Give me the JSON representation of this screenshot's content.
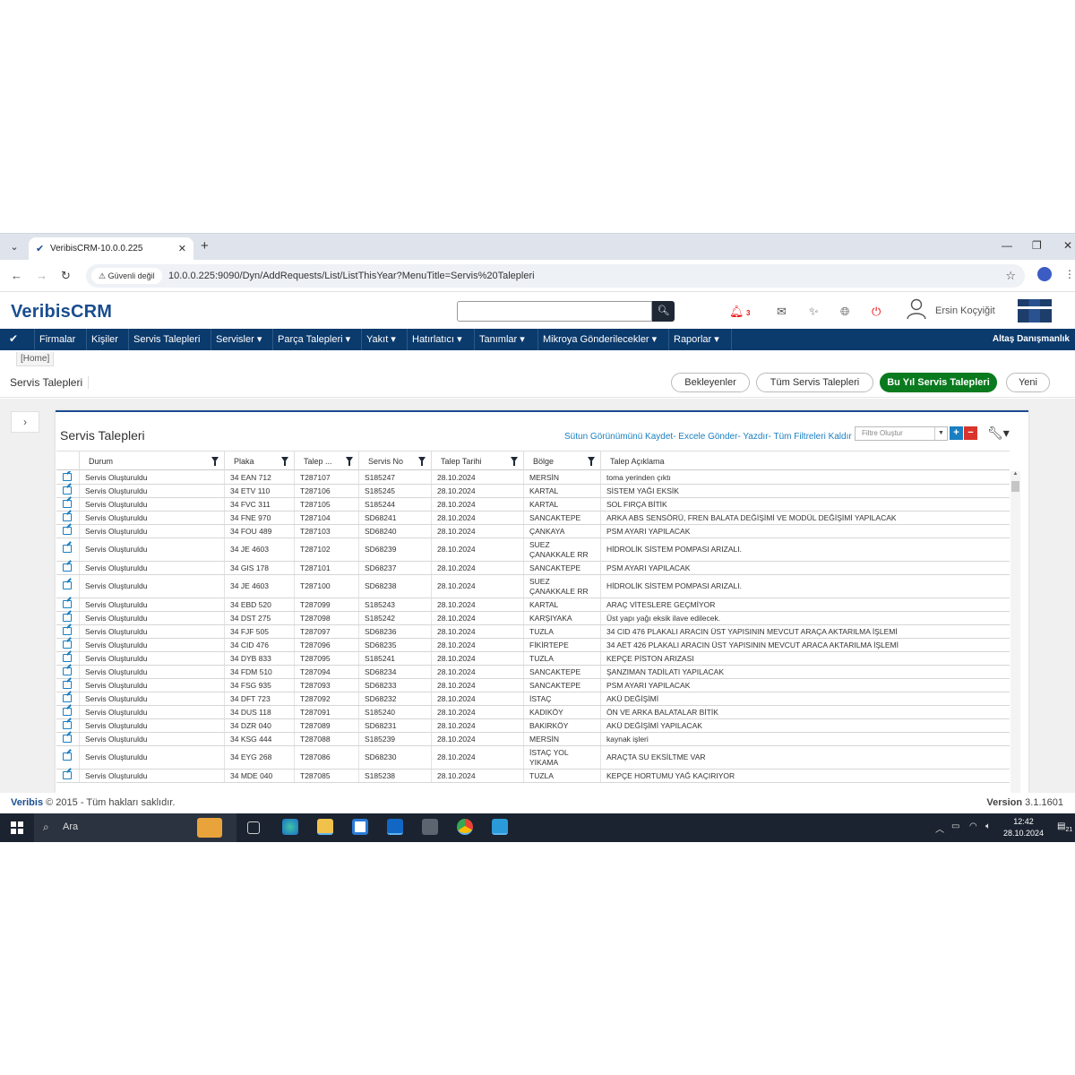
{
  "browser": {
    "tab_title": "VeribisCRM-10.0.0.225",
    "security_label": "Güvenli değil",
    "url": "10.0.0.225:9090/Dyn/AddRequests/List/ListThisYear?MenuTitle=Servis%20Talepleri"
  },
  "app": {
    "logo_a": "Veribis",
    "logo_b": "CRM",
    "notification_count": "3",
    "user_name": "Ersin Koçyiğit"
  },
  "nav": {
    "items": [
      "Firmalar",
      "Kişiler",
      "Servis Talepleri",
      "Servisler ▾",
      "Parça Talepleri ▾",
      "Yakıt ▾",
      "Hatırlatıcı ▾",
      "Tanımlar ▾",
      "Mikroya Gönderilecekler ▾",
      "Raporlar ▾"
    ],
    "company": "Altaş Danışmanlık"
  },
  "breadcrumb": "[Home]",
  "page_title": "Servis Talepleri",
  "buttons": {
    "waiting": "Bekleyenler",
    "all": "Tüm Servis Talepleri",
    "this_year": "Bu Yıl Servis Talepleri",
    "new": "Yeni"
  },
  "panel": {
    "title": "Servis Talepleri",
    "links": "Sütun Görünümünü Kaydet- Excele Gönder- Yazdır- Tüm Filtreleri Kaldır",
    "filter_placeholder": "Filtre Oluştur"
  },
  "columns": [
    "Durum",
    "Plaka",
    "Talep ...",
    "Servis No",
    "Talep Tarihi",
    "Bölge",
    "Talep Açıklama"
  ],
  "rows": [
    [
      "Servis Oluşturuldu",
      "34 EAN 712",
      "T287107",
      "S185247",
      "28.10.2024",
      "MERSİN",
      "toma yerinden çıktı"
    ],
    [
      "Servis Oluşturuldu",
      "34 ETV 110",
      "T287106",
      "S185245",
      "28.10.2024",
      "KARTAL",
      "SİSTEM YAĞI EKSİK"
    ],
    [
      "Servis Oluşturuldu",
      "34 FVC 311",
      "T287105",
      "S185244",
      "28.10.2024",
      "KARTAL",
      "SOL FIRÇA BİTİK"
    ],
    [
      "Servis Oluşturuldu",
      "34 FNE 970",
      "T287104",
      "SD68241",
      "28.10.2024",
      "SANCAKTEPE",
      "ARKA ABS SENSÖRÜ, FREN BALATA DEĞİŞİMİ VE MODÜL DEĞİŞİMİ YAPILACAK"
    ],
    [
      "Servis Oluşturuldu",
      "34 FOU 489",
      "T287103",
      "SD68240",
      "28.10.2024",
      "ÇANKAYA",
      "PSM AYARI YAPILACAK"
    ],
    [
      "Servis Oluşturuldu",
      "34 JE 4603",
      "T287102",
      "SD68239",
      "28.10.2024",
      "SUEZ\nÇANAKKALE RR",
      "HİDROLİK SİSTEM POMPASI ARIZALI."
    ],
    [
      "Servis Oluşturuldu",
      "34 GIS 178",
      "T287101",
      "SD68237",
      "28.10.2024",
      "SANCAKTEPE",
      "PSM AYARI YAPILACAK"
    ],
    [
      "Servis Oluşturuldu",
      "34 JE 4603",
      "T287100",
      "SD68238",
      "28.10.2024",
      "SUEZ\nÇANAKKALE RR",
      "HİDROLİK SİSTEM POMPASI ARIZALI."
    ],
    [
      "Servis Oluşturuldu",
      "34 EBD 520",
      "T287099",
      "S185243",
      "28.10.2024",
      "KARTAL",
      "ARAÇ VİTESLERE GEÇMİYOR"
    ],
    [
      "Servis Oluşturuldu",
      "34 DST 275",
      "T287098",
      "S185242",
      "28.10.2024",
      "KARŞIYAKA",
      "Üst yapı yağı eksik ilave edilecek."
    ],
    [
      "Servis Oluşturuldu",
      "34 FJF 505",
      "T287097",
      "SD68236",
      "28.10.2024",
      "TUZLA",
      "34 CID 476 PLAKALI ARACIN ÜST YAPISININ MEVCUT ARAÇA AKTARILMA İŞLEMİ"
    ],
    [
      "Servis Oluşturuldu",
      "34 CID 476",
      "T287096",
      "SD68235",
      "28.10.2024",
      "FİKİRTEPE",
      "34 AET 426 PLAKALI ARACIN ÜST YAPISININ MEVCUT ARACA AKTARILMA İŞLEMİ"
    ],
    [
      "Servis Oluşturuldu",
      "34 DYB 833",
      "T287095",
      "S185241",
      "28.10.2024",
      "TUZLA",
      "KEPÇE PİSTON ARIZASI"
    ],
    [
      "Servis Oluşturuldu",
      "34 FDM 510",
      "T287094",
      "SD68234",
      "28.10.2024",
      "SANCAKTEPE",
      "ŞANZIMAN TADİLATI YAPILACAK"
    ],
    [
      "Servis Oluşturuldu",
      "34 FSG 935",
      "T287093",
      "SD68233",
      "28.10.2024",
      "SANCAKTEPE",
      "PSM AYARI YAPILACAK"
    ],
    [
      "Servis Oluşturuldu",
      "34 DFT 723",
      "T287092",
      "SD68232",
      "28.10.2024",
      "İSTAÇ",
      "AKÜ DEĞİŞİMİ"
    ],
    [
      "Servis Oluşturuldu",
      "34 DUS 118",
      "T287091",
      "S185240",
      "28.10.2024",
      "KADIKÖY",
      "ÖN VE ARKA BALATALAR BİTİK"
    ],
    [
      "Servis Oluşturuldu",
      "34 DZR 040",
      "T287089",
      "SD68231",
      "28.10.2024",
      "BAKIRKÖY",
      "AKÜ DEĞİŞİMİ YAPILACAK"
    ],
    [
      "Servis Oluşturuldu",
      "34 KSG 444",
      "T287088",
      "S185239",
      "28.10.2024",
      "MERSİN",
      "kaynak işleri"
    ],
    [
      "Servis Oluşturuldu",
      "34 EYG 268",
      "T287086",
      "SD68230",
      "28.10.2024",
      "İSTAÇ YOL\nYIKAMA",
      "ARAÇTA SU EKSİLTME VAR"
    ],
    [
      "Servis Oluşturuldu",
      "34 MDE 040",
      "T287085",
      "S185238",
      "28.10.2024",
      "TUZLA",
      "KEPÇE HORTUMU YAĞ KAÇIRIYOR"
    ]
  ],
  "footer": {
    "brand": "Veribis",
    "copyright": "© 2015 - Tüm hakları saklıdır.",
    "version_label": "Version",
    "version": "3.1.1601"
  },
  "taskbar": {
    "search": "Ara",
    "time": "12:42",
    "date": "28.10.2024",
    "notif": "21"
  }
}
